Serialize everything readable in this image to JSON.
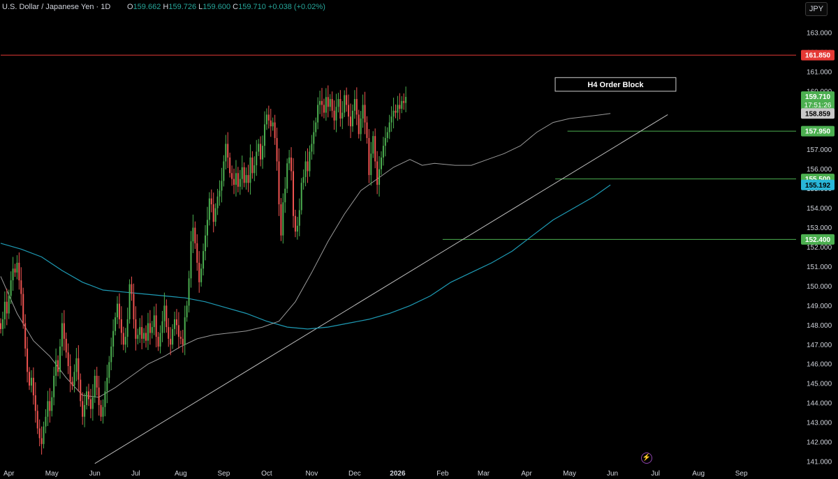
{
  "header": {
    "symbol": "U.S. Dollar / Japanese Yen · 1D",
    "open_label": "O",
    "open": "159.662",
    "high_label": "H",
    "high": "159.726",
    "low_label": "L",
    "low": "159.600",
    "close_label": "C",
    "close": "159.710",
    "change": "+0.038 (+0.02%)"
  },
  "currency_button": "JPY",
  "colors": {
    "up": "#26a69a",
    "up_body": "#26a69a",
    "candle_up": "#4caf50",
    "candle_down": "#ef5350",
    "ma_fast": "#c0c0c0",
    "ma_slow": "#1e9bb5",
    "resistance": "#e53935",
    "level": "#4caf50",
    "trendline": "#bdbdbd"
  },
  "chart_data": {
    "type": "candlestick",
    "title": "",
    "y_ticks": [
      "163.000",
      "162.000",
      "161.000",
      "160.000",
      "159.000",
      "158.000",
      "157.000",
      "156.000",
      "155.000",
      "154.000",
      "153.000",
      "152.000",
      "151.000",
      "150.000",
      "149.000",
      "148.000",
      "147.000",
      "146.000",
      "145.000",
      "144.000",
      "143.000",
      "142.000",
      "141.000"
    ],
    "ylim": [
      140.7,
      163.8
    ],
    "x_ticks": [
      {
        "label": "Apr",
        "t": 4
      },
      {
        "label": "May",
        "t": 25
      },
      {
        "label": "Jun",
        "t": 46
      },
      {
        "label": "Jul",
        "t": 66
      },
      {
        "label": "Aug",
        "t": 88
      },
      {
        "label": "Sep",
        "t": 109
      },
      {
        "label": "Oct",
        "t": 130
      },
      {
        "label": "Nov",
        "t": 152
      },
      {
        "label": "Dec",
        "t": 173
      },
      {
        "label": "2026",
        "t": 194
      },
      {
        "label": "Feb",
        "t": 216
      },
      {
        "label": "Mar",
        "t": 236
      },
      {
        "label": "Apr",
        "t": 257
      },
      {
        "label": "May",
        "t": 278
      },
      {
        "label": "Jun",
        "t": 299
      },
      {
        "label": "Jul",
        "t": 320
      },
      {
        "label": "Aug",
        "t": 341
      },
      {
        "label": "Sep",
        "t": 362
      }
    ],
    "closes": [
      147.8,
      148.3,
      149.2,
      148.6,
      149.5,
      150.3,
      150.9,
      150.7,
      151.2,
      150.3,
      149.6,
      148.1,
      146.8,
      145.6,
      144.9,
      145.3,
      144.4,
      143.6,
      142.7,
      142.2,
      141.9,
      142.8,
      143.3,
      144.1,
      143.6,
      144.3,
      145.4,
      146.2,
      145.6,
      146.9,
      148.1,
      147.3,
      146.6,
      145.9,
      145.1,
      144.9,
      145.6,
      146.3,
      145.2,
      144.1,
      143.3,
      143.9,
      144.6,
      144.2,
      143.7,
      144.3,
      145.4,
      144.8,
      143.9,
      143.3,
      143.8,
      144.6,
      145.3,
      146.1,
      146.9,
      147.7,
      148.4,
      149.1,
      148.3,
      147.6,
      147.0,
      147.4,
      148.3,
      150.1,
      149.6,
      148.3,
      147.3,
      147.5,
      147.9,
      147.3,
      147.6,
      147.2,
      148.1,
      147.6,
      147.9,
      148.5,
      147.4,
      146.9,
      147.6,
      148.2,
      149.0,
      147.9,
      147.3,
      147.0,
      147.8,
      148.3,
      148.0,
      147.4,
      147.3,
      147.0,
      148.4,
      149.0,
      150.4,
      152.3,
      153.0,
      152.2,
      151.2,
      150.2,
      150.9,
      151.8,
      152.6,
      153.4,
      154.5,
      154.2,
      153.3,
      154.0,
      154.6,
      154.9,
      155.4,
      156.4,
      157.3,
      156.6,
      155.8,
      155.5,
      155.2,
      155.8,
      155.1,
      155.5,
      156.1,
      155.3,
      155.7,
      155.3,
      156.6,
      155.8,
      156.2,
      156.9,
      157.3,
      156.5,
      157.2,
      158.3,
      158.8,
      158.5,
      158.2,
      158.4,
      157.6,
      156.4,
      154.2,
      152.6,
      154.3,
      155.0,
      156.3,
      156.6,
      155.9,
      153.6,
      152.8,
      153.1,
      153.9,
      155.3,
      155.6,
      156.4,
      155.9,
      156.9,
      157.3,
      157.9,
      158.4,
      159.3,
      159.5,
      159.3,
      158.9,
      159.7,
      159.2,
      159.6,
      159.0,
      158.5,
      159.2,
      159.6,
      158.6,
      158.9,
      159.8,
      159.3,
      158.7,
      158.2,
      159.0,
      159.6,
      158.8,
      157.8,
      158.6,
      159.3,
      158.4,
      157.6,
      155.7,
      156.8,
      157.7,
      156.4,
      155.2,
      156.0,
      156.6,
      157.2,
      157.6,
      157.9,
      158.4,
      158.7,
      159.0,
      158.9,
      159.3,
      159.1,
      159.5,
      159.4,
      159.71
    ],
    "ma_fast": [
      {
        "t": 0,
        "v": 150.5
      },
      {
        "t": 8,
        "v": 148.6
      },
      {
        "t": 16,
        "v": 147.2
      },
      {
        "t": 24,
        "v": 146.4
      },
      {
        "t": 32,
        "v": 145.3
      },
      {
        "t": 40,
        "v": 144.4
      },
      {
        "t": 48,
        "v": 144.3
      },
      {
        "t": 56,
        "v": 144.8
      },
      {
        "t": 64,
        "v": 145.4
      },
      {
        "t": 72,
        "v": 146.0
      },
      {
        "t": 80,
        "v": 146.4
      },
      {
        "t": 88,
        "v": 146.9
      },
      {
        "t": 96,
        "v": 147.3
      },
      {
        "t": 104,
        "v": 147.5
      },
      {
        "t": 112,
        "v": 147.6
      },
      {
        "t": 120,
        "v": 147.7
      },
      {
        "t": 128,
        "v": 147.9
      },
      {
        "t": 136,
        "v": 148.2
      },
      {
        "t": 144,
        "v": 149.2
      },
      {
        "t": 152,
        "v": 150.7
      },
      {
        "t": 160,
        "v": 152.3
      },
      {
        "t": 168,
        "v": 153.7
      },
      {
        "t": 176,
        "v": 154.9
      },
      {
        "t": 184,
        "v": 155.5
      },
      {
        "t": 192,
        "v": 156.1
      },
      {
        "t": 200,
        "v": 156.5
      },
      {
        "t": 206,
        "v": 156.2
      },
      {
        "t": 212,
        "v": 156.3
      },
      {
        "t": 222,
        "v": 156.2
      },
      {
        "t": 230,
        "v": 156.2
      },
      {
        "t": 238,
        "v": 156.5
      },
      {
        "t": 246,
        "v": 156.8
      },
      {
        "t": 254,
        "v": 157.2
      },
      {
        "t": 262,
        "v": 157.9
      },
      {
        "t": 270,
        "v": 158.4
      },
      {
        "t": 278,
        "v": 158.6
      },
      {
        "t": 286,
        "v": 158.7
      },
      {
        "t": 294,
        "v": 158.8
      },
      {
        "t": 298,
        "v": 158.86
      }
    ],
    "ma_slow": [
      {
        "t": 0,
        "v": 152.2
      },
      {
        "t": 10,
        "v": 151.9
      },
      {
        "t": 20,
        "v": 151.5
      },
      {
        "t": 30,
        "v": 150.8
      },
      {
        "t": 40,
        "v": 150.2
      },
      {
        "t": 50,
        "v": 149.8
      },
      {
        "t": 60,
        "v": 149.7
      },
      {
        "t": 70,
        "v": 149.6
      },
      {
        "t": 80,
        "v": 149.5
      },
      {
        "t": 90,
        "v": 149.4
      },
      {
        "t": 100,
        "v": 149.2
      },
      {
        "t": 110,
        "v": 148.9
      },
      {
        "t": 120,
        "v": 148.6
      },
      {
        "t": 130,
        "v": 148.2
      },
      {
        "t": 140,
        "v": 147.9
      },
      {
        "t": 150,
        "v": 147.8
      },
      {
        "t": 160,
        "v": 147.9
      },
      {
        "t": 170,
        "v": 148.1
      },
      {
        "t": 180,
        "v": 148.3
      },
      {
        "t": 190,
        "v": 148.6
      },
      {
        "t": 200,
        "v": 149.0
      },
      {
        "t": 210,
        "v": 149.5
      },
      {
        "t": 220,
        "v": 150.2
      },
      {
        "t": 230,
        "v": 150.7
      },
      {
        "t": 240,
        "v": 151.2
      },
      {
        "t": 250,
        "v": 151.8
      },
      {
        "t": 260,
        "v": 152.6
      },
      {
        "t": 270,
        "v": 153.4
      },
      {
        "t": 280,
        "v": 154.0
      },
      {
        "t": 290,
        "v": 154.6
      },
      {
        "t": 298,
        "v": 155.19
      }
    ],
    "levels": [
      {
        "name": "resistance",
        "value": 161.85,
        "label": "161.850",
        "color": "#e53935",
        "t_from": 0
      },
      {
        "name": "level-157950",
        "value": 157.95,
        "label": "157.950",
        "color": "#4caf50",
        "t_from": 277
      },
      {
        "name": "level-155500",
        "value": 155.5,
        "label": "155.500",
        "color": "#4caf50",
        "t_from": 271
      },
      {
        "name": "level-152400",
        "value": 152.4,
        "label": "152.400",
        "color": "#4caf50",
        "t_from": 216
      }
    ],
    "price_labels": [
      {
        "name": "last-price-label",
        "value": 159.71,
        "text": "159.710",
        "sub": "17:51:26",
        "color": "#4caf50"
      },
      {
        "name": "ma-fast-label",
        "value": 158.859,
        "text": "158.859",
        "color": "#c8c8c8"
      },
      {
        "name": "ma-slow-label",
        "value": 155.192,
        "text": "155.192",
        "color": "#29b6d8"
      }
    ],
    "trendline": {
      "t1": 46,
      "v1": 140.9,
      "t2": 326,
      "v2": 158.8
    },
    "annotation": {
      "text": "H4 Order Block",
      "t_from": 271,
      "t_to": 330,
      "top": 160.7,
      "bottom": 160.0
    }
  }
}
